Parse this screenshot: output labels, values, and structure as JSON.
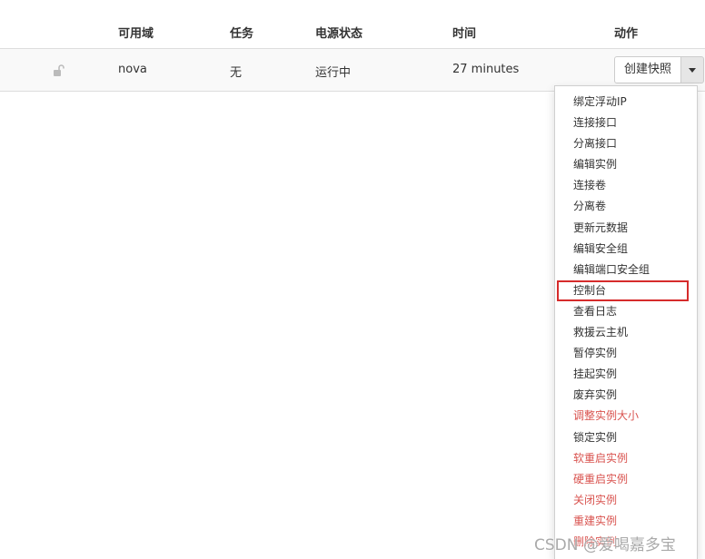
{
  "table": {
    "headers": {
      "zone": "可用域",
      "task": "任务",
      "power_state": "电源状态",
      "time": "时间",
      "actions": "动作"
    },
    "row": {
      "zone": "nova",
      "task": "无",
      "power_state": "运行中",
      "time": "27 minutes",
      "lock_icon": "unlock-icon"
    }
  },
  "actions": {
    "primary_label": "创建快照",
    "toggle_icon": "caret-down-icon",
    "menu": [
      {
        "label": "绑定浮动IP",
        "danger": false
      },
      {
        "label": "连接接口",
        "danger": false
      },
      {
        "label": "分离接口",
        "danger": false
      },
      {
        "label": "编辑实例",
        "danger": false
      },
      {
        "label": "连接卷",
        "danger": false
      },
      {
        "label": "分离卷",
        "danger": false
      },
      {
        "label": "更新元数据",
        "danger": false
      },
      {
        "label": "编辑安全组",
        "danger": false
      },
      {
        "label": "编辑端口安全组",
        "danger": false
      },
      {
        "label": "控制台",
        "danger": false
      },
      {
        "label": "查看日志",
        "danger": false
      },
      {
        "label": "救援云主机",
        "danger": false
      },
      {
        "label": "暂停实例",
        "danger": false
      },
      {
        "label": "挂起实例",
        "danger": false
      },
      {
        "label": "废弃实例",
        "danger": false
      },
      {
        "label": "调整实例大小",
        "danger": true
      },
      {
        "label": "锁定实例",
        "danger": false
      },
      {
        "label": "软重启实例",
        "danger": true
      },
      {
        "label": "硬重启实例",
        "danger": true
      },
      {
        "label": "关闭实例",
        "danger": true
      },
      {
        "label": "重建实例",
        "danger": true
      },
      {
        "label": "删除实例",
        "danger": true
      }
    ],
    "highlighted_item": "控制台"
  },
  "colors": {
    "danger": "#d9534f",
    "highlight_border": "#d62b2b"
  },
  "watermark": "CSDN @爱喝嘉多宝"
}
